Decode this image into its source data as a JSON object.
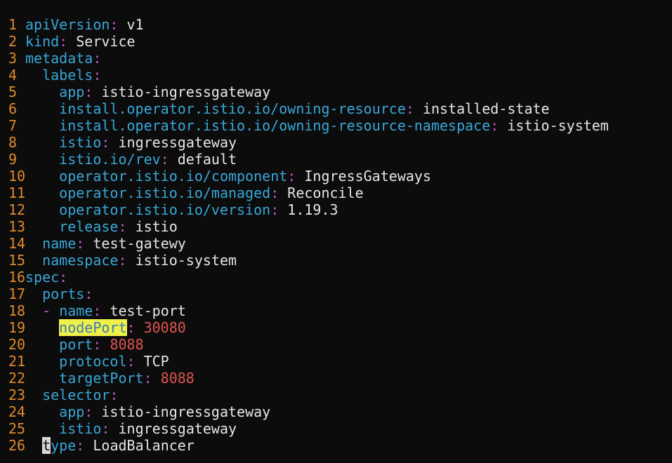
{
  "colors": {
    "background": "#0c0c0c",
    "line_number": "#e08a2c",
    "key": "#3aa7d8",
    "punctuation": "#c05bc8",
    "value": "#e6e6e6",
    "number": "#e0554f",
    "search_highlight": "#f0f04a",
    "cursor": "#d8d8d8"
  },
  "lines": [
    {
      "n": "1",
      "indent": "",
      "dash": "",
      "key": "apiVersion",
      "value": "v1",
      "vtype": "str"
    },
    {
      "n": "2",
      "indent": "",
      "dash": "",
      "key": "kind",
      "value": "Service",
      "vtype": "str"
    },
    {
      "n": "3",
      "indent": "",
      "dash": "",
      "key": "metadata",
      "value": "",
      "vtype": "none"
    },
    {
      "n": "4",
      "indent": "  ",
      "dash": "",
      "key": "labels",
      "value": "",
      "vtype": "none"
    },
    {
      "n": "5",
      "indent": "    ",
      "dash": "",
      "key": "app",
      "value": "istio-ingressgateway",
      "vtype": "str"
    },
    {
      "n": "6",
      "indent": "    ",
      "dash": "",
      "key": "install.operator.istio.io/owning-resource",
      "value": "installed-state",
      "vtype": "str"
    },
    {
      "n": "7",
      "indent": "    ",
      "dash": "",
      "key": "install.operator.istio.io/owning-resource-namespace",
      "value": "istio-system",
      "vtype": "str"
    },
    {
      "n": "8",
      "indent": "    ",
      "dash": "",
      "key": "istio",
      "value": "ingressgateway",
      "vtype": "str"
    },
    {
      "n": "9",
      "indent": "    ",
      "dash": "",
      "key": "istio.io/rev",
      "value": "default",
      "vtype": "str"
    },
    {
      "n": "10",
      "indent": "    ",
      "dash": "",
      "key": "operator.istio.io/component",
      "value": "IngressGateways",
      "vtype": "str"
    },
    {
      "n": "11",
      "indent": "    ",
      "dash": "",
      "key": "operator.istio.io/managed",
      "value": "Reconcile",
      "vtype": "str"
    },
    {
      "n": "12",
      "indent": "    ",
      "dash": "",
      "key": "operator.istio.io/version",
      "value": "1.19.3",
      "vtype": "str"
    },
    {
      "n": "13",
      "indent": "    ",
      "dash": "",
      "key": "release",
      "value": "istio",
      "vtype": "str"
    },
    {
      "n": "14",
      "indent": "  ",
      "dash": "",
      "key": "name",
      "value": "test-gatewy",
      "vtype": "str"
    },
    {
      "n": "15",
      "indent": "  ",
      "dash": "",
      "key": "namespace",
      "value": "istio-system",
      "vtype": "str"
    },
    {
      "n": "16",
      "indent": "",
      "dash": "",
      "key": "spec",
      "value": "",
      "vtype": "none"
    },
    {
      "n": "17",
      "indent": "  ",
      "dash": "",
      "key": "ports",
      "value": "",
      "vtype": "none"
    },
    {
      "n": "18",
      "indent": "  ",
      "dash": "- ",
      "key": "name",
      "value": "test-port",
      "vtype": "str"
    },
    {
      "n": "19",
      "indent": "    ",
      "dash": "",
      "key": "nodePort",
      "value": "30080",
      "vtype": "num",
      "highlight": true
    },
    {
      "n": "20",
      "indent": "    ",
      "dash": "",
      "key": "port",
      "value": "8088",
      "vtype": "num"
    },
    {
      "n": "21",
      "indent": "    ",
      "dash": "",
      "key": "protocol",
      "value": "TCP",
      "vtype": "str"
    },
    {
      "n": "22",
      "indent": "    ",
      "dash": "",
      "key": "targetPort",
      "value": "8088",
      "vtype": "num"
    },
    {
      "n": "23",
      "indent": "  ",
      "dash": "",
      "key": "selector",
      "value": "",
      "vtype": "none"
    },
    {
      "n": "24",
      "indent": "    ",
      "dash": "",
      "key": "app",
      "value": "istio-ingressgateway",
      "vtype": "str"
    },
    {
      "n": "25",
      "indent": "    ",
      "dash": "",
      "key": "istio",
      "value": "ingressgateway",
      "vtype": "str"
    },
    {
      "n": "26",
      "indent": "  ",
      "dash": "",
      "key": "type",
      "value": "LoadBalancer",
      "vtype": "str",
      "cursor": true
    }
  ]
}
